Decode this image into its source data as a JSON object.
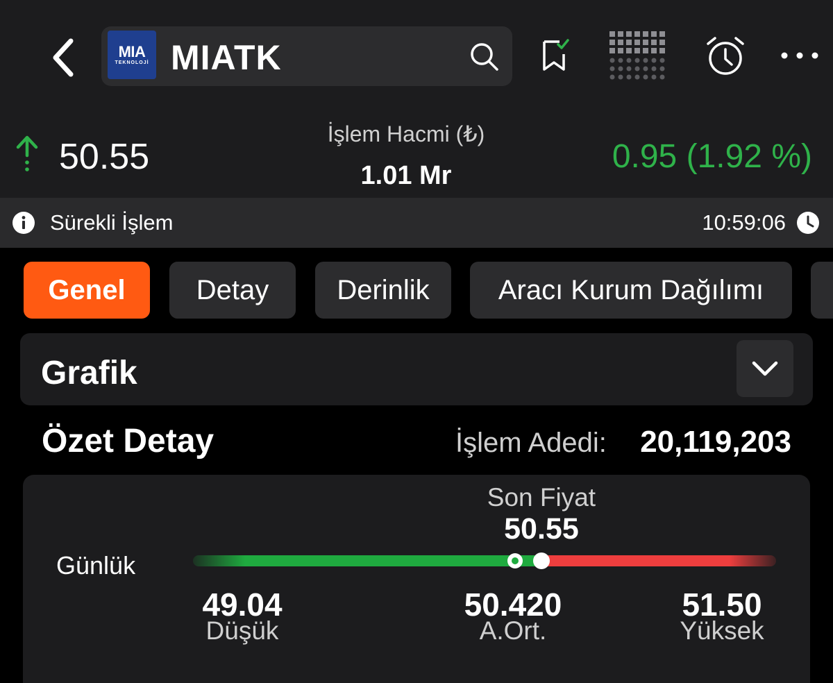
{
  "header": {
    "logo_text": "MIA",
    "logo_subtext": "TEKNOLOJİ",
    "ticker": "MIATK",
    "icons": [
      "back-chevron-icon",
      "search-icon",
      "bookmark-check-icon",
      "heatmap-grid-icon",
      "alarm-clock-icon",
      "more-dots-icon"
    ]
  },
  "quote": {
    "direction": "up",
    "price": "50.55",
    "volume_label": "İşlem Hacmi (₺)",
    "volume_value": "1.01 Mr",
    "change": "0.95 (1.92 %)",
    "change_color": "#2fb24a"
  },
  "status": {
    "label": "Sürekli İşlem",
    "time": "10:59:06"
  },
  "tabs": [
    {
      "label": "Genel",
      "active": true
    },
    {
      "label": "Detay",
      "active": false
    },
    {
      "label": "Derinlik",
      "active": false
    },
    {
      "label": "Aracı Kurum Dağılımı",
      "active": false
    }
  ],
  "grafik": {
    "title": "Grafik"
  },
  "summary": {
    "title": "Özet Detay",
    "trade_count_label": "İşlem Adedi:",
    "trade_count_value": "20,119,203"
  },
  "daily_range": {
    "label": "Günlük",
    "last_label": "Son Fiyat",
    "last_value": "50.55",
    "low_value": "49.04",
    "low_label": "Düşük",
    "avg_value": "50.420",
    "avg_label": "A.Ort.",
    "high_value": "51.50",
    "high_label": "Yüksek",
    "low": 49.04,
    "avg": 50.42,
    "last": 50.55,
    "high": 51.5
  },
  "colors": {
    "accent": "#ff5a12",
    "positive": "#1faa3f",
    "negative": "#ee3e3e"
  }
}
